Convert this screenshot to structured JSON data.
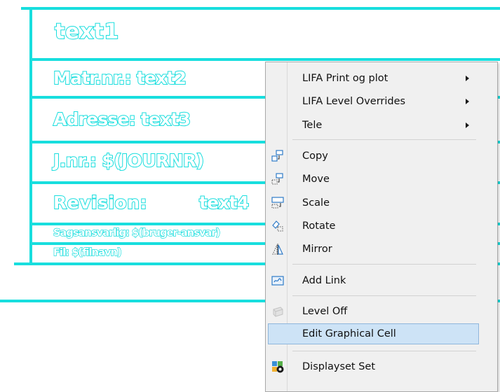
{
  "drawing": {
    "title_text": "text1",
    "matr_text": "Matr.nr.: text2",
    "adresse_text": "Adresse: text3",
    "jnr_text": "J.nr.: $(JOURNR)",
    "revision_label": "Revision:",
    "revision_value": "text4",
    "sagsansvarlig_text": "Sagsansvarlig: $(bruger-ansvar)",
    "fil_text": "Fil: $(filnavn)",
    "line_color": "#18dede",
    "bracket_text": ")"
  },
  "context_menu": {
    "items": [
      {
        "label": "LIFA Print og plot",
        "submenu": true
      },
      {
        "label": "LIFA Level Overrides",
        "submenu": true
      },
      {
        "label": "Tele",
        "submenu": true
      },
      {
        "label": "Copy",
        "icon": "copy-icon"
      },
      {
        "label": "Move",
        "icon": "move-icon"
      },
      {
        "label": "Scale",
        "icon": "scale-icon"
      },
      {
        "label": "Rotate",
        "icon": "rotate-icon"
      },
      {
        "label": "Mirror",
        "icon": "mirror-icon"
      },
      {
        "label": "Add Link",
        "icon": "link-icon"
      },
      {
        "label": "Level Off",
        "icon": "level-off-icon"
      },
      {
        "label": "Edit Graphical Cell",
        "highlighted": true
      },
      {
        "label": "Displayset Set",
        "icon": "displayset-icon"
      }
    ],
    "highlight_color": "#cde3f6"
  }
}
